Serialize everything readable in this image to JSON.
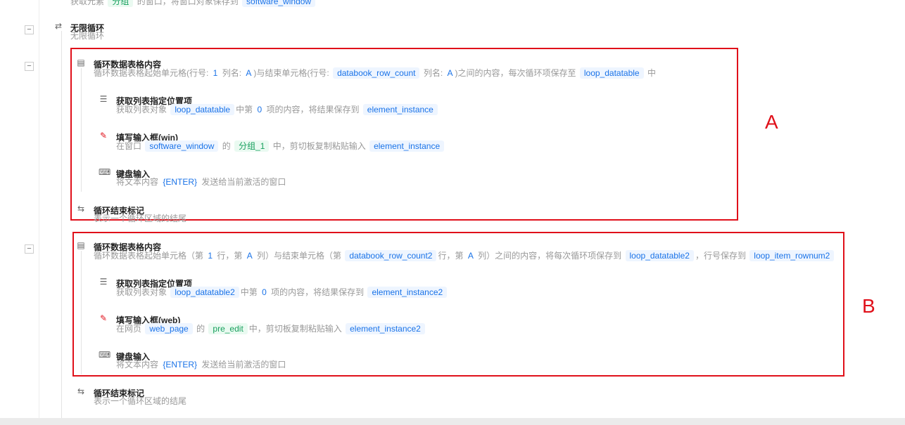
{
  "rows": [
    {
      "id": "prev-desc",
      "desc": [
        [
          "获取元素 ",
          "t"
        ],
        [
          "分组",
          "g"
        ],
        [
          " 的窗口，将窗口对象保存到 ",
          "t"
        ],
        [
          "software_window",
          "v"
        ]
      ]
    },
    {
      "id": "infinite-loop",
      "icon": "loop-icon",
      "title": "无限循环",
      "desc": [
        [
          "无限循环",
          "t"
        ]
      ]
    },
    {
      "id": "loop-table-a",
      "icon": "table-loop-icon",
      "title": "循环数据表格内容",
      "desc": [
        [
          "循环数据表格起始单元格(行号: ",
          "t"
        ],
        [
          "1",
          "n"
        ],
        [
          " 列名: ",
          "t"
        ],
        [
          "A",
          "n"
        ],
        [
          ")与结束单元格(行号: ",
          "t"
        ],
        [
          "databook_row_count",
          "v"
        ],
        [
          " 列名: ",
          "t"
        ],
        [
          "A",
          "n"
        ],
        [
          ")之间的内容，每次循环项保存至 ",
          "t"
        ],
        [
          "loop_datatable",
          "v"
        ],
        [
          " 中",
          "t"
        ]
      ]
    },
    {
      "id": "get-list-item-a",
      "icon": "list-icon",
      "title": "获取列表指定位置项",
      "desc": [
        [
          "获取列表对象 ",
          "t"
        ],
        [
          "loop_datatable",
          "v"
        ],
        [
          "中第 ",
          "t"
        ],
        [
          "0",
          "n"
        ],
        [
          " 项的内容，将结果保存到 ",
          "t"
        ],
        [
          "element_instance",
          "v"
        ]
      ]
    },
    {
      "id": "fill-input-win",
      "icon": "edit-icon",
      "title": "填写输入框(win)",
      "desc": [
        [
          "在窗口 ",
          "t"
        ],
        [
          "software_window",
          "v"
        ],
        [
          " 的 ",
          "t"
        ],
        [
          "分组_1",
          "g"
        ],
        [
          " 中，剪切板复制粘贴输入 ",
          "t"
        ],
        [
          "element_instance",
          "v"
        ]
      ]
    },
    {
      "id": "keyboard-a",
      "icon": "keyboard-icon",
      "title": "键盘输入",
      "desc": [
        [
          "将文本内容 ",
          "t"
        ],
        [
          "{ENTER}",
          "n"
        ],
        [
          " 发送给当前激活的窗口",
          "t"
        ]
      ]
    },
    {
      "id": "loop-end-a",
      "icon": "loop-end-icon",
      "title": "循环结束标记",
      "desc": [
        [
          "表示一个循环区域的结尾",
          "t"
        ]
      ]
    },
    {
      "id": "loop-table-b",
      "icon": "table-loop-icon",
      "title": "循环数据表格内容",
      "desc": [
        [
          "循环数据表格起始单元格（第 ",
          "t"
        ],
        [
          "1",
          "n"
        ],
        [
          " 行，第 ",
          "t"
        ],
        [
          "A",
          "n"
        ],
        [
          " 列）与结束单元格（第 ",
          "t"
        ],
        [
          "databook_row_count2",
          "v"
        ],
        [
          "行，第 ",
          "t"
        ],
        [
          "A",
          "n"
        ],
        [
          " 列）之间的内容，将每次循环项保存到 ",
          "t"
        ],
        [
          "loop_datatable2",
          "v"
        ],
        [
          "，行号保存到 ",
          "t"
        ],
        [
          "loop_item_rownum2",
          "v"
        ]
      ]
    },
    {
      "id": "get-list-item-b",
      "icon": "list-icon",
      "title": "获取列表指定位置项",
      "desc": [
        [
          "获取列表对象 ",
          "t"
        ],
        [
          "loop_datatable2",
          "v"
        ],
        [
          "中第 ",
          "t"
        ],
        [
          "0",
          "n"
        ],
        [
          " 项的内容，将结果保存到 ",
          "t"
        ],
        [
          "element_instance2",
          "v"
        ]
      ]
    },
    {
      "id": "fill-input-web",
      "icon": "edit-icon",
      "title": "填写输入框(web)",
      "desc": [
        [
          "在网页 ",
          "t"
        ],
        [
          "web_page",
          "v"
        ],
        [
          " 的 ",
          "t"
        ],
        [
          "pre_edit",
          "g"
        ],
        [
          "中，剪切板复制粘贴输入 ",
          "t"
        ],
        [
          "element_instance2",
          "v"
        ]
      ]
    },
    {
      "id": "keyboard-b",
      "icon": "keyboard-icon",
      "title": "键盘输入",
      "desc": [
        [
          "将文本内容 ",
          "t"
        ],
        [
          "{ENTER}",
          "n"
        ],
        [
          " 发送给当前激活的窗口",
          "t"
        ]
      ]
    },
    {
      "id": "loop-end-b",
      "icon": "loop-end-icon",
      "title": "循环结束标记",
      "desc": [
        [
          "表示一个循环区域的结尾",
          "t"
        ]
      ]
    }
  ],
  "annotations": {
    "a": "A",
    "b": "B"
  },
  "collapse_symbol": "−",
  "icons": {
    "loop-icon": "⇄",
    "table-loop-icon": "▤",
    "list-icon": "☰",
    "edit-icon": "✎",
    "keyboard-icon": "⌨",
    "loop-end-icon": "⇆"
  },
  "colors": {
    "accent": "#1a73e8",
    "highlight": "#e0101a",
    "green": "#17a05d"
  }
}
